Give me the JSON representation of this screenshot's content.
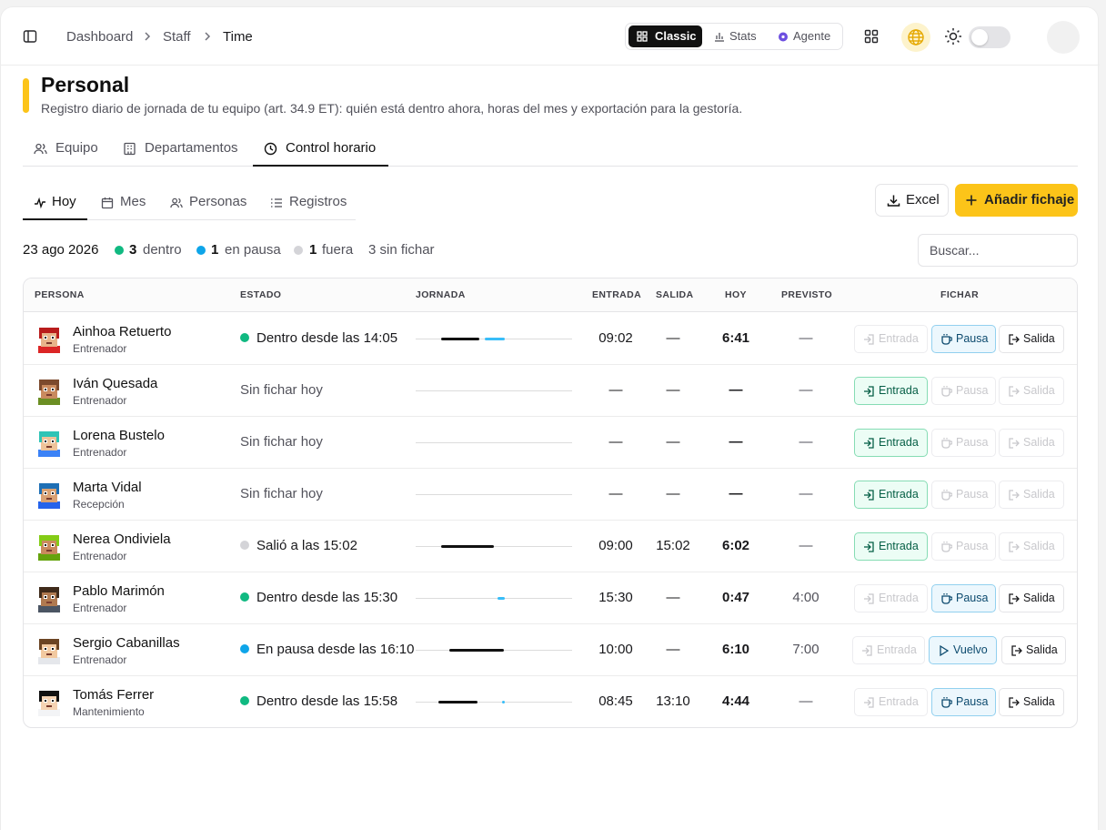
{
  "breadcrumb": [
    "Dashboard",
    "Staff",
    "Time"
  ],
  "modes": [
    {
      "label": "Classic",
      "active": true,
      "icon": "grid-icon"
    },
    {
      "label": "Stats",
      "active": false,
      "icon": "bar-chart-icon"
    },
    {
      "label": "Agente",
      "active": false,
      "icon": "agent-icon"
    }
  ],
  "page": {
    "title": "Personal",
    "subtitle": "Registro diario de jornada de tu equipo (art. 34.9 ET): quién está dentro ahora, horas del mes y exportación para la gestoría."
  },
  "tabs": [
    "Equipo",
    "Departamentos",
    "Control horario"
  ],
  "subtabs": [
    "Hoy",
    "Mes",
    "Personas",
    "Registros"
  ],
  "actions": {
    "excel": "Excel",
    "add": "Añadir fichaje"
  },
  "summary": {
    "date": "23 ago 2026",
    "dentro_count": "3",
    "dentro_label": "dentro",
    "pausa_count": "1",
    "pausa_label": "en pausa",
    "fuera_count": "1",
    "fuera_label": "fuera",
    "sin_fichar": "3 sin fichar"
  },
  "search": {
    "placeholder": "Buscar..."
  },
  "columns": [
    "PERSONA",
    "ESTADO",
    "JORNADA",
    "ENTRADA",
    "SALIDA",
    "HOY",
    "PREVISTO",
    "FICHAR"
  ],
  "colors": {
    "accent": "#fcc419",
    "dentro": "#10b981",
    "pausa": "#0ea5e9",
    "fuera": "#d4d4d8"
  },
  "rows": [
    {
      "name": "Ainhoa Retuerto",
      "role": "Entrenador",
      "status": "Dentro desde las 14:05",
      "status_kind": "dentro",
      "entrada": "09:02",
      "salida": "—",
      "hoy": "6:41",
      "previsto": "—",
      "buttons": [
        "Entrada",
        "Pausa",
        "Salida"
      ],
      "enabled": [
        false,
        true,
        true
      ],
      "avatar": {
        "skin": "#e8b48a",
        "hair": "#b91c1c",
        "shirt": "#dc2626"
      }
    },
    {
      "name": "Iván Quesada",
      "role": "Entrenador",
      "status": "Sin fichar hoy",
      "status_kind": "none",
      "entrada": "—",
      "salida": "—",
      "hoy": "—",
      "previsto": "—",
      "buttons": [
        "Entrada",
        "Pausa",
        "Salida"
      ],
      "enabled": [
        true,
        false,
        false
      ],
      "avatar": {
        "skin": "#c98a5e",
        "hair": "#7c4a2d",
        "shirt": "#6b8e23"
      }
    },
    {
      "name": "Lorena Bustelo",
      "role": "Entrenador",
      "status": "Sin fichar hoy",
      "status_kind": "none",
      "entrada": "—",
      "salida": "—",
      "hoy": "—",
      "previsto": "—",
      "buttons": [
        "Entrada",
        "Pausa",
        "Salida"
      ],
      "enabled": [
        true,
        false,
        false
      ],
      "avatar": {
        "skin": "#eec39a",
        "hair": "#2ec4b6",
        "shirt": "#3b82f6"
      }
    },
    {
      "name": "Marta Vidal",
      "role": "Recepción",
      "status": "Sin fichar hoy",
      "status_kind": "none",
      "entrada": "—",
      "salida": "—",
      "hoy": "—",
      "previsto": "—",
      "buttons": [
        "Entrada",
        "Pausa",
        "Salida"
      ],
      "enabled": [
        true,
        false,
        false
      ],
      "avatar": {
        "skin": "#d9a173",
        "hair": "#1e6fb5",
        "shirt": "#2563eb"
      }
    },
    {
      "name": "Nerea Ondiviela",
      "role": "Entrenador",
      "status": "Salió a las 15:02",
      "status_kind": "fuera",
      "entrada": "09:00",
      "salida": "15:02",
      "hoy": "6:02",
      "previsto": "—",
      "buttons": [
        "Entrada",
        "Pausa",
        "Salida"
      ],
      "enabled": [
        true,
        false,
        false
      ],
      "avatar": {
        "skin": "#c98a5e",
        "hair": "#84cc16",
        "shirt": "#65a30d"
      }
    },
    {
      "name": "Pablo Marimón",
      "role": "Entrenador",
      "status": "Dentro desde las 15:30",
      "status_kind": "dentro",
      "entrada": "15:30",
      "salida": "—",
      "hoy": "0:47",
      "previsto": "4:00",
      "buttons": [
        "Entrada",
        "Pausa",
        "Salida"
      ],
      "enabled": [
        false,
        true,
        true
      ],
      "avatar": {
        "skin": "#b07a50",
        "hair": "#3f2a1a",
        "shirt": "#4b5563"
      }
    },
    {
      "name": "Sergio Cabanillas",
      "role": "Entrenador",
      "status": "En pausa desde las 16:10",
      "status_kind": "pausa",
      "entrada": "10:00",
      "salida": "—",
      "hoy": "6:10",
      "previsto": "7:00",
      "buttons": [
        "Entrada",
        "Vuelvo",
        "Salida"
      ],
      "enabled": [
        false,
        true,
        true
      ],
      "avatar": {
        "skin": "#f2c9a0",
        "hair": "#6b4423",
        "shirt": "#e5e7eb"
      }
    },
    {
      "name": "Tomás Ferrer",
      "role": "Mantenimiento",
      "status": "Dentro desde las 15:58",
      "status_kind": "dentro",
      "entrada": "08:45",
      "salida": "13:10",
      "hoy": "4:44",
      "previsto": "—",
      "buttons": [
        "Entrada",
        "Pausa",
        "Salida"
      ],
      "enabled": [
        false,
        true,
        true
      ],
      "avatar": {
        "skin": "#f5d3b3",
        "hair": "#111111",
        "shirt": "#f3f4f6"
      }
    }
  ]
}
